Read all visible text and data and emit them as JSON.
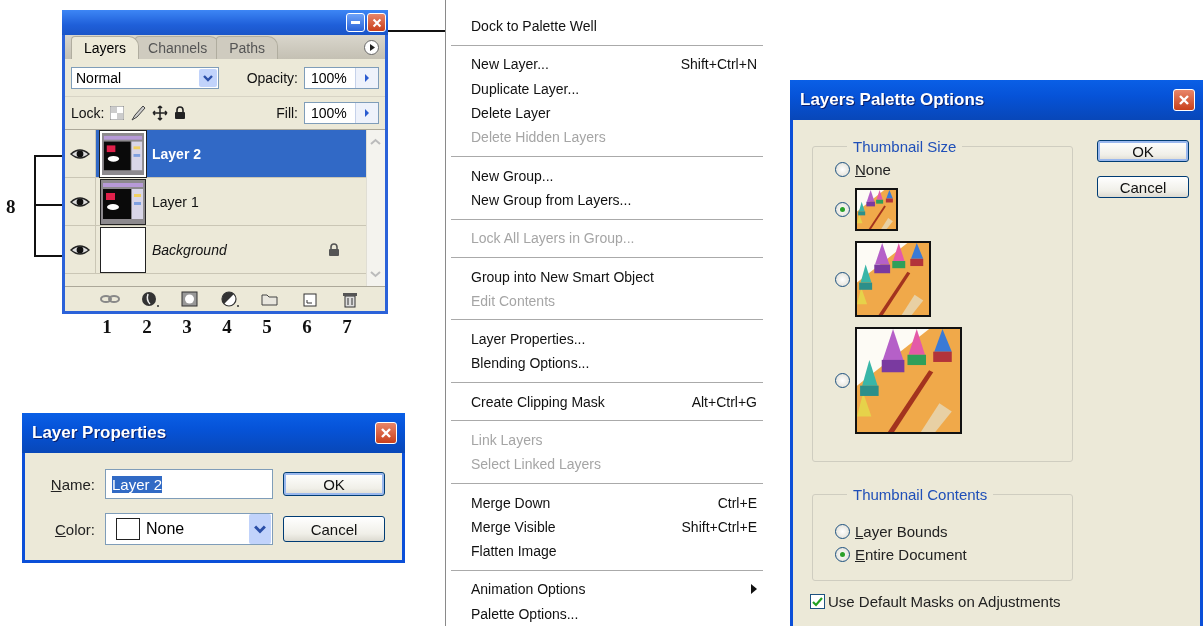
{
  "layers_palette": {
    "tabs": [
      {
        "label": "Layers",
        "selected": true
      },
      {
        "label": "Channels",
        "selected": false
      },
      {
        "label": "Paths",
        "selected": false
      }
    ],
    "blend_mode": "Normal",
    "opacity_label": "Opacity:",
    "opacity": "100%",
    "lock_label": "Lock:",
    "fill_label": "Fill:",
    "fill": "100%",
    "layers": [
      {
        "kind": "layer",
        "name": "Layer 2",
        "selected": true,
        "visible": true
      },
      {
        "kind": "layer",
        "name": "Layer 1",
        "selected": false,
        "visible": true
      },
      {
        "kind": "background",
        "name": "Background",
        "selected": false,
        "visible": true
      }
    ]
  },
  "callouts": {
    "toolbar_numbers": [
      "1",
      "2",
      "3",
      "4",
      "5",
      "6",
      "7"
    ],
    "layers_bracket": "8"
  },
  "layer_properties": {
    "title": "Layer Properties",
    "name_label": "Name:",
    "name_value": "Layer 2",
    "name_value_selected": true,
    "color_label": "Color:",
    "color_value": "None",
    "buttons": [
      {
        "label": "OK",
        "default": true
      },
      {
        "label": "Cancel",
        "default": false
      }
    ]
  },
  "palette_menu": {
    "sections": [
      [
        {
          "label": "Dock to Palette Well",
          "disabled": false,
          "submenu": false
        }
      ],
      [
        {
          "label": "New Layer...",
          "shortcut": "Shift+Ctrl+N",
          "disabled": false,
          "submenu": false
        },
        {
          "label": "Duplicate Layer...",
          "disabled": false,
          "submenu": false
        },
        {
          "label": "Delete Layer",
          "disabled": false,
          "submenu": false
        },
        {
          "label": "Delete Hidden Layers",
          "disabled": true,
          "submenu": false
        }
      ],
      [
        {
          "label": "New Group...",
          "disabled": false,
          "submenu": false
        },
        {
          "label": "New Group from Layers...",
          "disabled": false,
          "submenu": false
        }
      ],
      [
        {
          "label": "Lock All Layers in Group...",
          "disabled": true,
          "submenu": false
        }
      ],
      [
        {
          "label": "Group into New Smart Object",
          "disabled": false,
          "submenu": false
        },
        {
          "label": "Edit Contents",
          "disabled": true,
          "submenu": false
        }
      ],
      [
        {
          "label": "Layer Properties...",
          "disabled": false,
          "submenu": false
        },
        {
          "label": "Blending Options...",
          "disabled": false,
          "submenu": false
        }
      ],
      [
        {
          "label": "Create Clipping Mask",
          "shortcut": "Alt+Ctrl+G",
          "disabled": false,
          "submenu": false
        }
      ],
      [
        {
          "label": "Link Layers",
          "disabled": true,
          "submenu": false
        },
        {
          "label": "Select Linked Layers",
          "disabled": true,
          "submenu": false
        }
      ],
      [
        {
          "label": "Merge Down",
          "shortcut": "Ctrl+E",
          "disabled": false,
          "submenu": false
        },
        {
          "label": "Merge Visible",
          "shortcut": "Shift+Ctrl+E",
          "disabled": false,
          "submenu": false
        },
        {
          "label": "Flatten Image",
          "disabled": false,
          "submenu": false
        }
      ],
      [
        {
          "label": "Animation Options",
          "disabled": false,
          "submenu": true
        },
        {
          "label": "Palette Options...",
          "disabled": false,
          "submenu": false
        }
      ]
    ]
  },
  "palette_options": {
    "title": "Layers Palette Options",
    "thumbnail_size": {
      "legend": "Thumbnail Size",
      "options": [
        {
          "kind": "label",
          "label": "None",
          "selected": false
        },
        {
          "kind": "small",
          "selected": true
        },
        {
          "kind": "medium",
          "selected": false
        },
        {
          "kind": "large",
          "selected": false
        }
      ]
    },
    "thumbnail_contents": {
      "legend": "Thumbnail Contents",
      "options": [
        {
          "label": "Layer Bounds",
          "selected": false
        },
        {
          "label": "Entire Document",
          "selected": true
        }
      ]
    },
    "default_masks": {
      "label": "Use Default Masks on Adjustments",
      "checked": true
    },
    "buttons": [
      {
        "label": "OK",
        "default": true
      },
      {
        "label": "Cancel",
        "default": false
      }
    ]
  }
}
